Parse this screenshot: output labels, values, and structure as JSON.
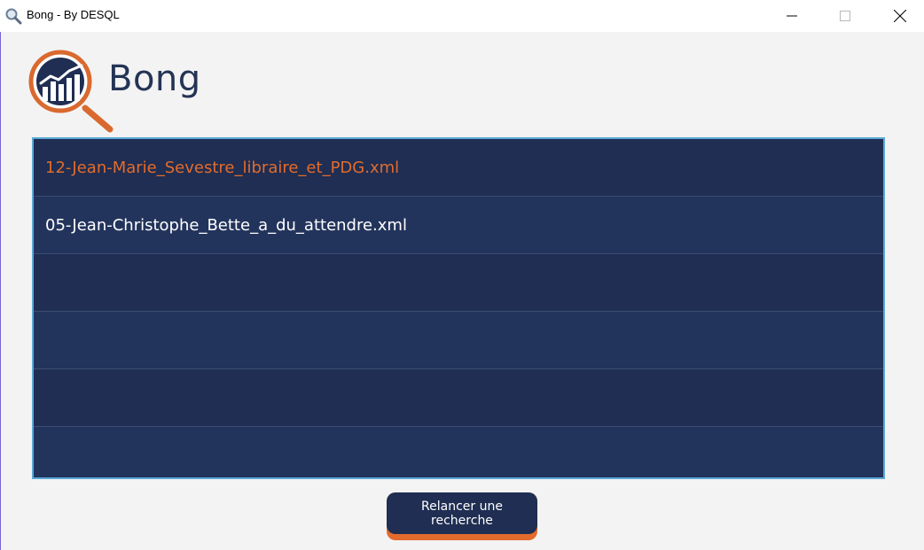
{
  "window": {
    "title": "Bong - By DESQL"
  },
  "app": {
    "name": "Bong"
  },
  "results": {
    "items": [
      {
        "label": "12-Jean-Marie_Sevestre_libraire_et_PDG.xml",
        "selected": true
      },
      {
        "label": "05-Jean-Christophe_Bette_a_du_attendre.xml",
        "selected": false
      },
      {
        "label": "",
        "selected": false
      },
      {
        "label": "",
        "selected": false
      },
      {
        "label": "",
        "selected": false
      },
      {
        "label": "",
        "selected": false
      }
    ]
  },
  "actions": {
    "restart_label": "Relancer une recherche"
  },
  "colors": {
    "accent": "#e36b2c",
    "navy": "#1f2e52",
    "list_border": "#5aa8d6"
  }
}
